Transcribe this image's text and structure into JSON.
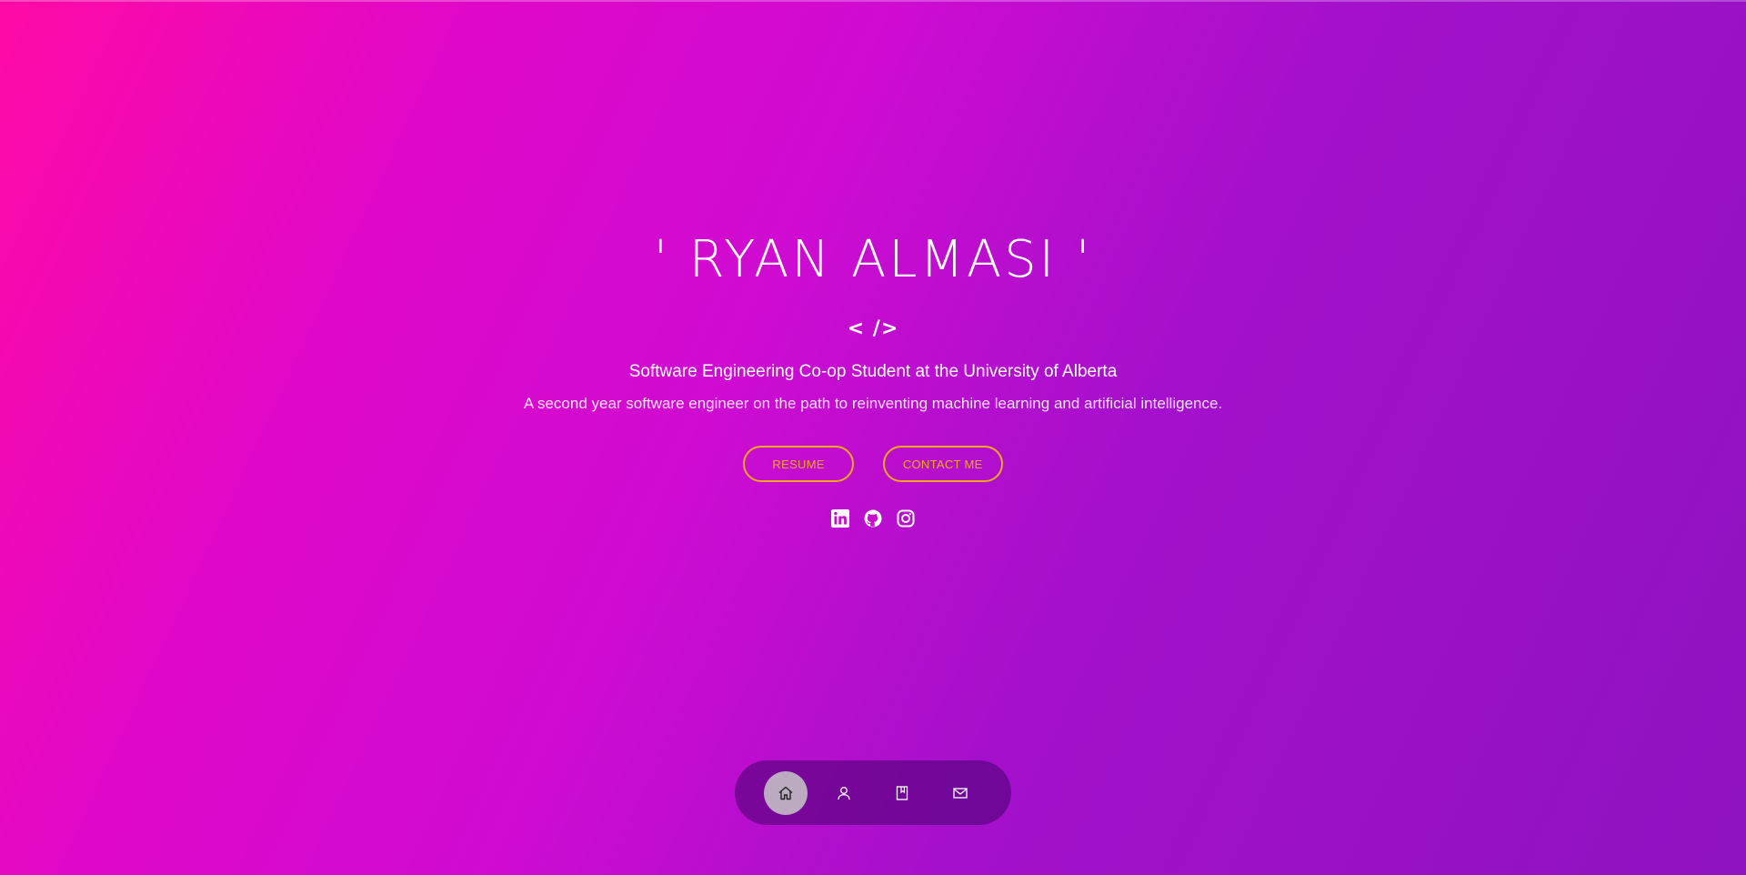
{
  "hero": {
    "name": "' RYAN ALMASI '",
    "code_tag": "< />",
    "subtitle": "Software Engineering Co-op Student at the University of Alberta",
    "description": "A second year software engineer on the path to reinventing machine learning and artificial intelligence."
  },
  "buttons": {
    "resume_label": "RESUME",
    "contact_label": "CONTACT ME"
  },
  "socials": [
    "linkedin-icon",
    "github-icon",
    "instagram-icon"
  ],
  "dock": {
    "items": [
      "home-icon",
      "user-icon",
      "book-icon",
      "mail-icon"
    ],
    "active": "home-icon"
  },
  "colors": {
    "accent": "#f0a81e",
    "gradient_start": "#ff0aa5",
    "gradient_end": "#8e12c0"
  }
}
